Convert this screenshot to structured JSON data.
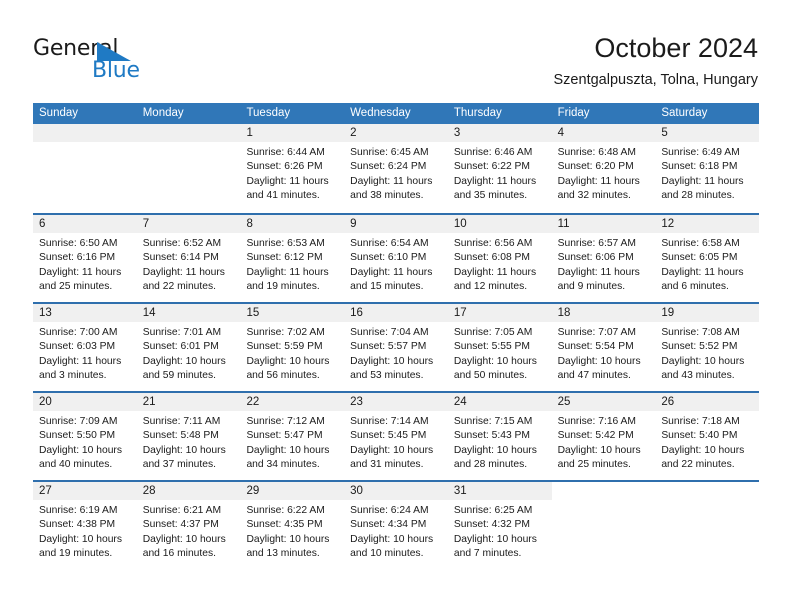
{
  "brand": {
    "name_part1": "General",
    "name_part2": "Blue",
    "triangle_color": "#1f7ac4"
  },
  "header": {
    "title": "October 2024",
    "subtitle": "Szentgalpuszta, Tolna, Hungary"
  },
  "theme": {
    "header_blue": "#3077b8",
    "row_separator_blue": "#2f6fad",
    "day_band_gray": "#f0f0f0",
    "text_color": "#1b1b1b"
  },
  "weekdays": [
    "Sunday",
    "Monday",
    "Tuesday",
    "Wednesday",
    "Thursday",
    "Friday",
    "Saturday"
  ],
  "weeks": [
    [
      {
        "day": "",
        "sunrise": "",
        "sunset": "",
        "daylight": "",
        "empty": true
      },
      {
        "day": "",
        "sunrise": "",
        "sunset": "",
        "daylight": "",
        "empty": true
      },
      {
        "day": "1",
        "sunrise": "Sunrise: 6:44 AM",
        "sunset": "Sunset: 6:26 PM",
        "daylight": "Daylight: 11 hours and 41 minutes."
      },
      {
        "day": "2",
        "sunrise": "Sunrise: 6:45 AM",
        "sunset": "Sunset: 6:24 PM",
        "daylight": "Daylight: 11 hours and 38 minutes."
      },
      {
        "day": "3",
        "sunrise": "Sunrise: 6:46 AM",
        "sunset": "Sunset: 6:22 PM",
        "daylight": "Daylight: 11 hours and 35 minutes."
      },
      {
        "day": "4",
        "sunrise": "Sunrise: 6:48 AM",
        "sunset": "Sunset: 6:20 PM",
        "daylight": "Daylight: 11 hours and 32 minutes."
      },
      {
        "day": "5",
        "sunrise": "Sunrise: 6:49 AM",
        "sunset": "Sunset: 6:18 PM",
        "daylight": "Daylight: 11 hours and 28 minutes."
      }
    ],
    [
      {
        "day": "6",
        "sunrise": "Sunrise: 6:50 AM",
        "sunset": "Sunset: 6:16 PM",
        "daylight": "Daylight: 11 hours and 25 minutes."
      },
      {
        "day": "7",
        "sunrise": "Sunrise: 6:52 AM",
        "sunset": "Sunset: 6:14 PM",
        "daylight": "Daylight: 11 hours and 22 minutes."
      },
      {
        "day": "8",
        "sunrise": "Sunrise: 6:53 AM",
        "sunset": "Sunset: 6:12 PM",
        "daylight": "Daylight: 11 hours and 19 minutes."
      },
      {
        "day": "9",
        "sunrise": "Sunrise: 6:54 AM",
        "sunset": "Sunset: 6:10 PM",
        "daylight": "Daylight: 11 hours and 15 minutes."
      },
      {
        "day": "10",
        "sunrise": "Sunrise: 6:56 AM",
        "sunset": "Sunset: 6:08 PM",
        "daylight": "Daylight: 11 hours and 12 minutes."
      },
      {
        "day": "11",
        "sunrise": "Sunrise: 6:57 AM",
        "sunset": "Sunset: 6:06 PM",
        "daylight": "Daylight: 11 hours and 9 minutes."
      },
      {
        "day": "12",
        "sunrise": "Sunrise: 6:58 AM",
        "sunset": "Sunset: 6:05 PM",
        "daylight": "Daylight: 11 hours and 6 minutes."
      }
    ],
    [
      {
        "day": "13",
        "sunrise": "Sunrise: 7:00 AM",
        "sunset": "Sunset: 6:03 PM",
        "daylight": "Daylight: 11 hours and 3 minutes."
      },
      {
        "day": "14",
        "sunrise": "Sunrise: 7:01 AM",
        "sunset": "Sunset: 6:01 PM",
        "daylight": "Daylight: 10 hours and 59 minutes."
      },
      {
        "day": "15",
        "sunrise": "Sunrise: 7:02 AM",
        "sunset": "Sunset: 5:59 PM",
        "daylight": "Daylight: 10 hours and 56 minutes."
      },
      {
        "day": "16",
        "sunrise": "Sunrise: 7:04 AM",
        "sunset": "Sunset: 5:57 PM",
        "daylight": "Daylight: 10 hours and 53 minutes."
      },
      {
        "day": "17",
        "sunrise": "Sunrise: 7:05 AM",
        "sunset": "Sunset: 5:55 PM",
        "daylight": "Daylight: 10 hours and 50 minutes."
      },
      {
        "day": "18",
        "sunrise": "Sunrise: 7:07 AM",
        "sunset": "Sunset: 5:54 PM",
        "daylight": "Daylight: 10 hours and 47 minutes."
      },
      {
        "day": "19",
        "sunrise": "Sunrise: 7:08 AM",
        "sunset": "Sunset: 5:52 PM",
        "daylight": "Daylight: 10 hours and 43 minutes."
      }
    ],
    [
      {
        "day": "20",
        "sunrise": "Sunrise: 7:09 AM",
        "sunset": "Sunset: 5:50 PM",
        "daylight": "Daylight: 10 hours and 40 minutes."
      },
      {
        "day": "21",
        "sunrise": "Sunrise: 7:11 AM",
        "sunset": "Sunset: 5:48 PM",
        "daylight": "Daylight: 10 hours and 37 minutes."
      },
      {
        "day": "22",
        "sunrise": "Sunrise: 7:12 AM",
        "sunset": "Sunset: 5:47 PM",
        "daylight": "Daylight: 10 hours and 34 minutes."
      },
      {
        "day": "23",
        "sunrise": "Sunrise: 7:14 AM",
        "sunset": "Sunset: 5:45 PM",
        "daylight": "Daylight: 10 hours and 31 minutes."
      },
      {
        "day": "24",
        "sunrise": "Sunrise: 7:15 AM",
        "sunset": "Sunset: 5:43 PM",
        "daylight": "Daylight: 10 hours and 28 minutes."
      },
      {
        "day": "25",
        "sunrise": "Sunrise: 7:16 AM",
        "sunset": "Sunset: 5:42 PM",
        "daylight": "Daylight: 10 hours and 25 minutes."
      },
      {
        "day": "26",
        "sunrise": "Sunrise: 7:18 AM",
        "sunset": "Sunset: 5:40 PM",
        "daylight": "Daylight: 10 hours and 22 minutes."
      }
    ],
    [
      {
        "day": "27",
        "sunrise": "Sunrise: 6:19 AM",
        "sunset": "Sunset: 4:38 PM",
        "daylight": "Daylight: 10 hours and 19 minutes."
      },
      {
        "day": "28",
        "sunrise": "Sunrise: 6:21 AM",
        "sunset": "Sunset: 4:37 PM",
        "daylight": "Daylight: 10 hours and 16 minutes."
      },
      {
        "day": "29",
        "sunrise": "Sunrise: 6:22 AM",
        "sunset": "Sunset: 4:35 PM",
        "daylight": "Daylight: 10 hours and 13 minutes."
      },
      {
        "day": "30",
        "sunrise": "Sunrise: 6:24 AM",
        "sunset": "Sunset: 4:34 PM",
        "daylight": "Daylight: 10 hours and 10 minutes."
      },
      {
        "day": "31",
        "sunrise": "Sunrise: 6:25 AM",
        "sunset": "Sunset: 4:32 PM",
        "daylight": "Daylight: 10 hours and 7 minutes."
      },
      {
        "day": "",
        "sunrise": "",
        "sunset": "",
        "daylight": "",
        "empty": true,
        "blank": true
      },
      {
        "day": "",
        "sunrise": "",
        "sunset": "",
        "daylight": "",
        "empty": true,
        "blank": true
      }
    ]
  ]
}
